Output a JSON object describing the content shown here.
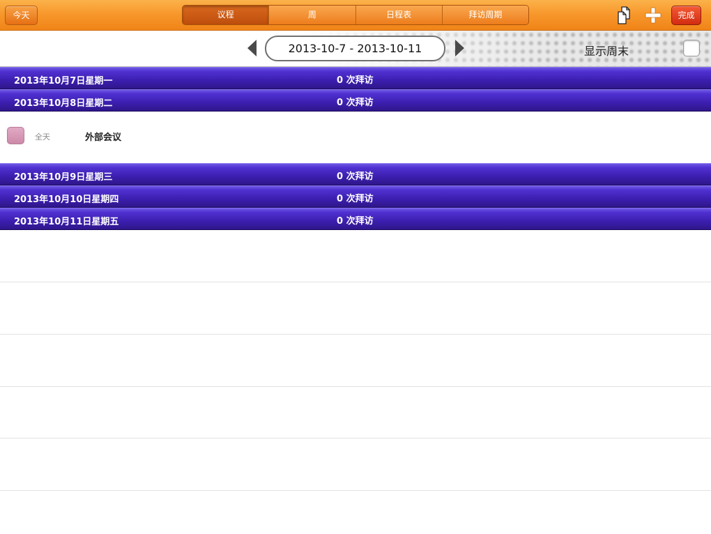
{
  "toolbar": {
    "today_label": "今天",
    "done_label": "完成",
    "tabs": [
      {
        "label": "议程",
        "active": true
      },
      {
        "label": "周",
        "active": false
      },
      {
        "label": "日程表",
        "active": false
      },
      {
        "label": "拜访周期",
        "active": false
      }
    ],
    "icons": [
      "copy-icon",
      "plus-icon"
    ]
  },
  "date_nav": {
    "range": "2013-10-7 - 2013-10-11",
    "show_weekend_label": "显示周末",
    "show_weekend_checked": false
  },
  "days": [
    {
      "date": "2013年10月7日星期一",
      "count": "0 次拜访"
    },
    {
      "date": "2013年10月8日星期二",
      "count": "0 次拜访"
    },
    {
      "date": "2013年10月9日星期三",
      "count": "0 次拜访"
    },
    {
      "date": "2013年10月10日星期四",
      "count": "0 次拜访"
    },
    {
      "date": "2013年10月11日星期五",
      "count": "0 次拜访"
    }
  ],
  "event": {
    "all_day_label": "全天",
    "title": "外部会议",
    "color": "#d99ab8"
  },
  "colors": {
    "toolbar_orange": "#f7962a",
    "day_header_purple": "#4527c0",
    "done_red": "#e0401f"
  }
}
